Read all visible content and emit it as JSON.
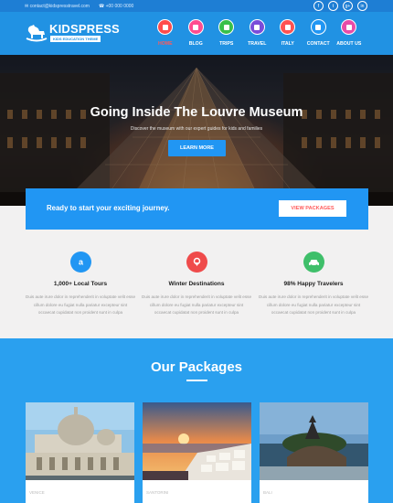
{
  "topbar": {
    "email": "contact@kidspresstravel.com",
    "phone": "+00 000 0000",
    "social": [
      "f",
      "t",
      "g+",
      "in"
    ]
  },
  "brand": {
    "name": "KIDSPRESS",
    "tagline": "KIDS EDUCATION THEME"
  },
  "nav": [
    {
      "label": "HOME",
      "active": true,
      "color": "#ff4c4c"
    },
    {
      "label": "BLOG",
      "active": false,
      "color": "#ff4c8f"
    },
    {
      "label": "TRIPS",
      "active": false,
      "color": "#39c04a"
    },
    {
      "label": "TRAVEL",
      "active": false,
      "color": "#7a4cd9"
    },
    {
      "label": "ITALY",
      "active": false,
      "color": "#ff5252"
    },
    {
      "label": "CONTACT",
      "active": false,
      "color": "#2196f3"
    },
    {
      "label": "ABOUT US",
      "active": false,
      "color": "#e84ca8"
    }
  ],
  "hero": {
    "title": "Going Inside The Louvre Museum",
    "subtitle": "Discover the museum with our expert guides for kids and families",
    "button": "LEARN MORE"
  },
  "cta": {
    "text": "Ready to start your exciting journey.",
    "button": "VIEW PACKAGES"
  },
  "features": [
    {
      "title": "1,000+ Local Tours",
      "icon": "amazon-icon",
      "color": "#2196f3",
      "desc": [
        "Duis aute irure dolor in reprehenderit in voluptate velit esse",
        "cillum dolore eu fugiat nulla pariatur excepteur sint",
        "occaecat cupidatat non proident sunt in culpa"
      ]
    },
    {
      "title": "Winter Destinations",
      "icon": "location-icon",
      "color": "#ef4b4b",
      "desc": [
        "Duis aute irure dolor in reprehenderit in voluptate velit esse",
        "cillum dolore eu fugiat nulla pariatur excepteur sint",
        "occaecat cupidatat non proident sunt in culpa"
      ]
    },
    {
      "title": "98% Happy Travelers",
      "icon": "car-icon",
      "color": "#3fbf6a",
      "desc": [
        "Duis aute irure dolor in reprehenderit in voluptate velit esse",
        "cillum dolore eu fugiat nulla pariatur excepteur sint",
        "occaecat cupidatat non proident sunt in culpa"
      ]
    }
  ],
  "packages": {
    "heading": "Our Packages",
    "cards": [
      {
        "caption": "VENICE"
      },
      {
        "caption": "SANTORINI"
      },
      {
        "caption": "BALI"
      }
    ]
  }
}
